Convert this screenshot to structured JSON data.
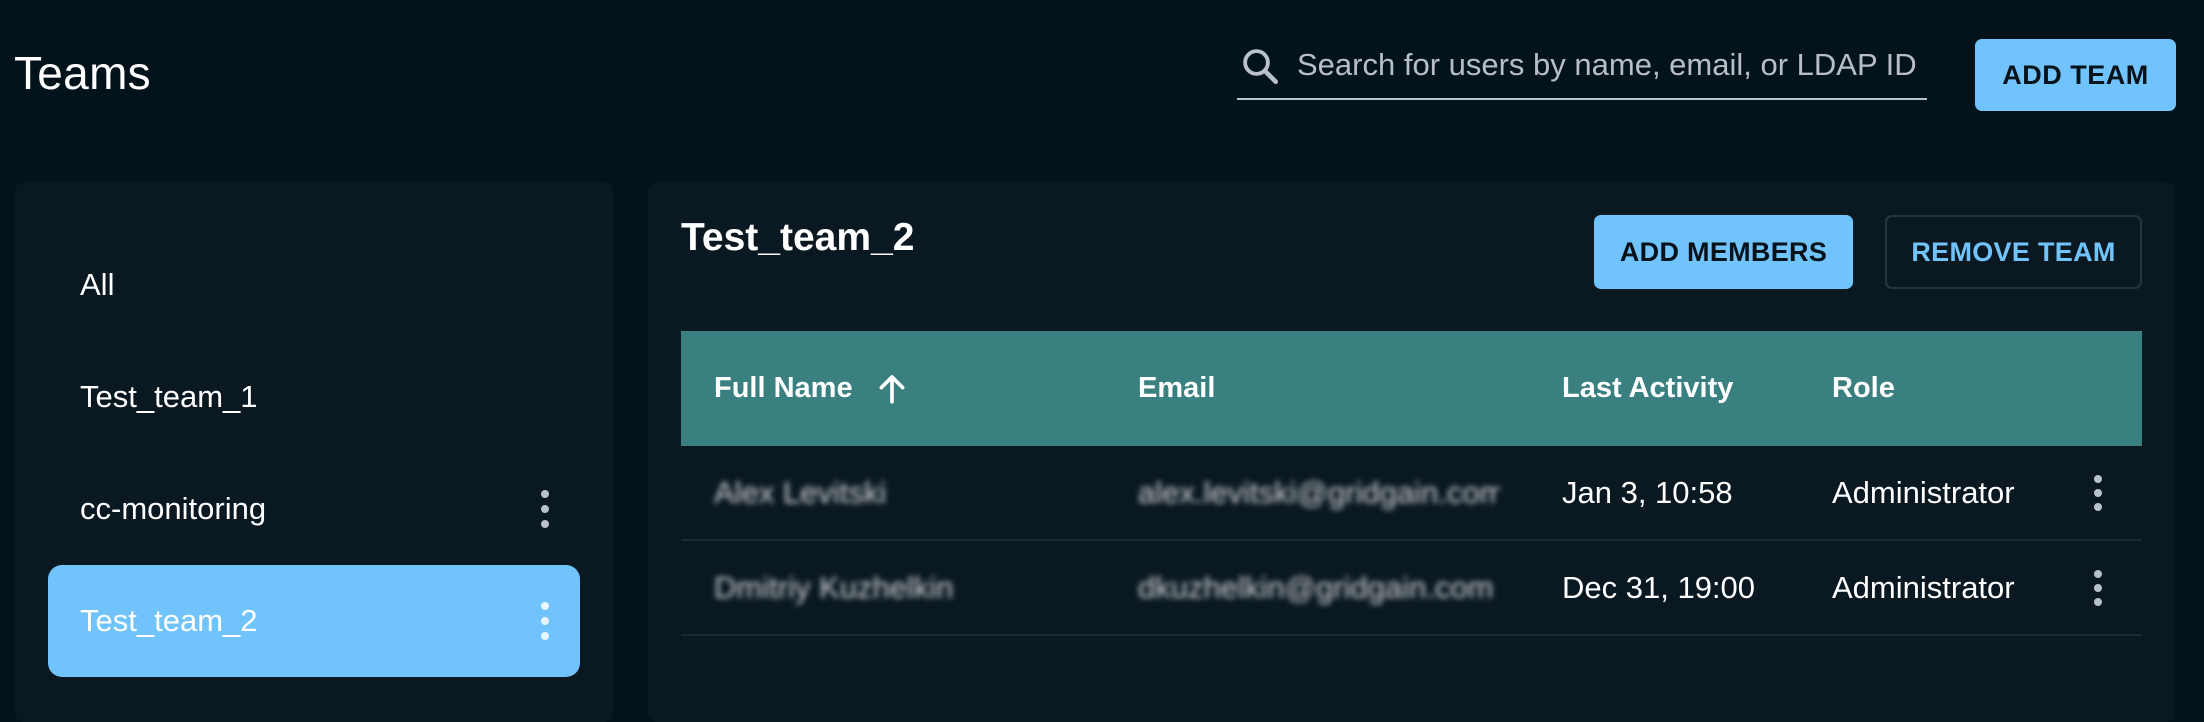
{
  "header": {
    "title": "Teams",
    "search_placeholder": "Search for users by name, email, or LDAP ID",
    "search_value": "",
    "add_team_label": "ADD TEAM"
  },
  "sidebar": {
    "items": [
      {
        "label": "All",
        "selected": false,
        "has_menu": false
      },
      {
        "label": "Test_team_1",
        "selected": false,
        "has_menu": false
      },
      {
        "label": "cc-monitoring",
        "selected": false,
        "has_menu": true
      },
      {
        "label": "Test_team_2",
        "selected": true,
        "has_menu": true
      }
    ]
  },
  "main": {
    "team_title": "Test_team_2",
    "add_members_label": "ADD MEMBERS",
    "remove_team_label": "REMOVE TEAM",
    "table": {
      "columns": [
        "Full Name",
        "Email",
        "Last Activity",
        "Role"
      ],
      "sort_icon": "arrow-up-icon",
      "rows": [
        {
          "full_name": "Alex Levitski",
          "email": "alex.levitski@gridgain.com",
          "last_activity": "Jan 3, 10:58",
          "role": "Administrator"
        },
        {
          "full_name": "Dmitriy Kuzhelkin",
          "email": "dkuzhelkin@gridgain.com",
          "last_activity": "Dec 31, 19:00",
          "role": "Administrator"
        }
      ]
    }
  },
  "colors": {
    "background": "#03131c",
    "panel": "#0a1822",
    "accent": "#71c4fb",
    "table_header": "#3a8080"
  }
}
